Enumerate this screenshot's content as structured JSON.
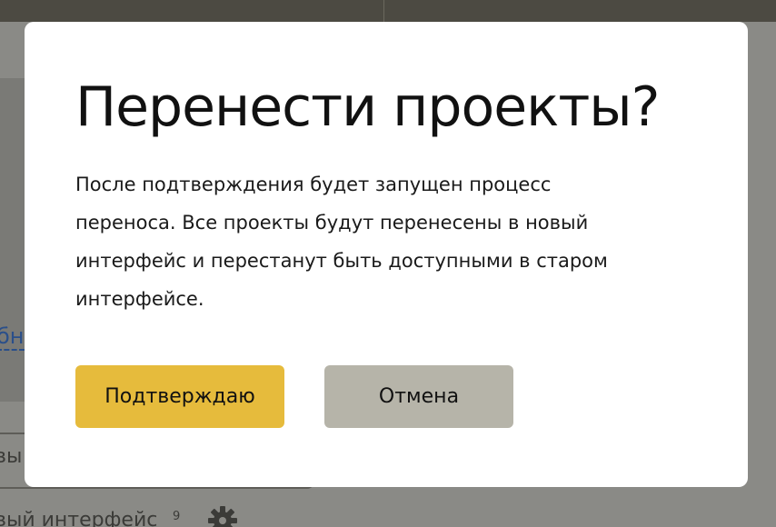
{
  "background": {
    "link_fragment": "бн",
    "input_fragment": "вы",
    "footer_label_fragment": "вый интерфейс",
    "footer_count": "9"
  },
  "dialog": {
    "title": "Перенести проекты?",
    "body": "После подтверждения будет запущен процесс переноса. Все проекты будут перенесены в новый интерфейс и перестанут быть доступными в старом интерфейсе.",
    "confirm_label": "Подтверждаю",
    "cancel_label": "Отмена"
  },
  "colors": {
    "confirm_button": "#e6bb3c",
    "cancel_button": "#b6b4a9",
    "overlay": "#8a8a86",
    "dialog_bg": "#ffffff"
  },
  "icons": {
    "footer_settings": "gear-icon"
  }
}
